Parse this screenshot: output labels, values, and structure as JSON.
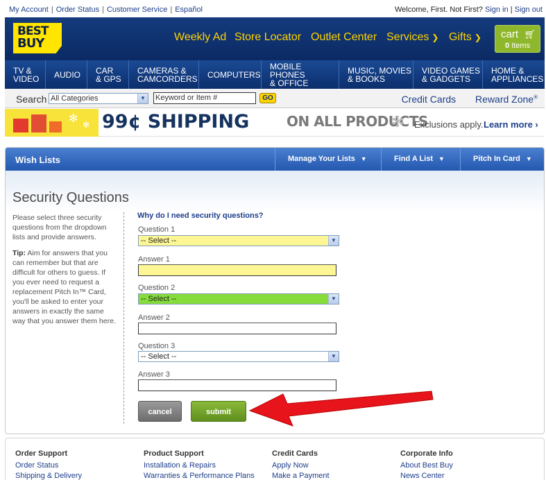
{
  "util": {
    "links": [
      "My Account",
      "Order Status",
      "Customer Service",
      "Español"
    ],
    "welcome": "Welcome, First. Not First?",
    "sign_in": "Sign in",
    "sign_out": "Sign out"
  },
  "brand": {
    "logo_line1": "BEST",
    "logo_line2": "BUY",
    "logo_color": "#ffe500",
    "header_color": "#0c2f6d"
  },
  "header_nav": {
    "weekly_ad": "Weekly Ad",
    "store_locator": "Store Locator",
    "outlet_center": "Outlet Center",
    "services": "Services",
    "gifts": "Gifts"
  },
  "cart": {
    "label": "cart",
    "count": "0",
    "items_label": "Items",
    "icon": "cart-icon"
  },
  "categories": [
    [
      "TV &",
      "VIDEO"
    ],
    [
      "AUDIO"
    ],
    [
      "CAR",
      "& GPS"
    ],
    [
      "CAMERAS &",
      "CAMCORDERS"
    ],
    [
      "COMPUTERS"
    ],
    [
      "MOBILE PHONES",
      "& OFFICE"
    ],
    [
      "MUSIC, MOVIES",
      "& BOOKS"
    ],
    [
      "VIDEO GAMES",
      "& GADGETS"
    ],
    [
      "HOME &",
      "APPLIANCES"
    ]
  ],
  "search": {
    "label": "Search",
    "category_selected": "All Categories",
    "keyword_value": "Keyword or Item #",
    "go_label": "GO",
    "credit_cards": "Credit Cards",
    "reward_zone": "Reward Zone",
    "reward_mark": "®"
  },
  "promo": {
    "headline": "99¢ SHIPPING",
    "subline": "ON ALL PRODUCTS",
    "exclusions": "Exclusions apply.",
    "learn_more": "Learn more ›"
  },
  "panel": {
    "title": "Wish Lists",
    "tabs": [
      "Manage Your Lists",
      "Find A List",
      "Pitch In Card"
    ],
    "heading": "Security Questions",
    "help_text": "Please select three security questions from the dropdown lists and provide answers.",
    "tip_label": "Tip:",
    "tip_text": " Aim for answers that you can remember but that are difficult for others to guess. If you ever need to request a replacement Pitch In™ Card, you'll be asked to enter your answers in exactly the same way that you answer them here.",
    "why_link": "Why do I need security questions?"
  },
  "form": {
    "question1_label": "Question 1",
    "question1_value": "-- Select --",
    "answer1_label": "Answer 1",
    "answer1_value": "",
    "question2_label": "Question 2",
    "question2_value": "-- Select --",
    "answer2_label": "Answer 2",
    "answer2_value": "",
    "question3_label": "Question 3",
    "question3_value": "-- Select --",
    "answer3_label": "Answer 3",
    "answer3_value": "",
    "cancel_label": "cancel",
    "submit_label": "submit"
  },
  "footer": {
    "columns": [
      {
        "heading": "Order Support",
        "links": [
          "Order Status",
          "Shipping & Delivery"
        ]
      },
      {
        "heading": "Product Support",
        "links": [
          "Installation & Repairs",
          "Warranties & Performance Plans"
        ]
      },
      {
        "heading": "Credit Cards",
        "links": [
          "Apply Now",
          "Make a Payment"
        ]
      },
      {
        "heading": "Corporate Info",
        "links": [
          "About Best Buy",
          "News Center"
        ]
      }
    ]
  }
}
